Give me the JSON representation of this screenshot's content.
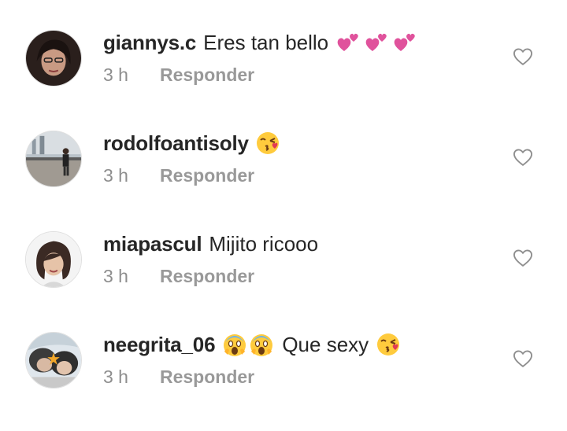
{
  "comments": [
    {
      "username": "giannys.c",
      "text": "Eres tan bello",
      "emojis": [
        "two-hearts",
        "two-hearts",
        "two-hearts"
      ],
      "time": "3 h",
      "reply_label": "Responder",
      "avatar_icon": "user-avatar"
    },
    {
      "username": "rodolfoantisoly",
      "text": "",
      "emojis": [
        "kissing-face"
      ],
      "time": "3 h",
      "reply_label": "Responder",
      "avatar_icon": "user-avatar"
    },
    {
      "username": "miapascul",
      "text": "Mijito ricooo",
      "emojis": [],
      "time": "3 h",
      "reply_label": "Responder",
      "avatar_icon": "user-avatar"
    },
    {
      "username": "neegrita_06",
      "text": "Que sexy",
      "emojis_before": [
        "screaming-face",
        "screaming-face"
      ],
      "emojis": [
        "kissing-face"
      ],
      "time": "3 h",
      "reply_label": "Responder",
      "avatar_icon": "user-avatar"
    }
  ],
  "like_icon": "heart-outline-icon",
  "colors": {
    "username": "#262626",
    "meta": "#8e8e8e",
    "heart_emoji": "#e0529c",
    "emoji_yellow": "#ffcb3d"
  }
}
